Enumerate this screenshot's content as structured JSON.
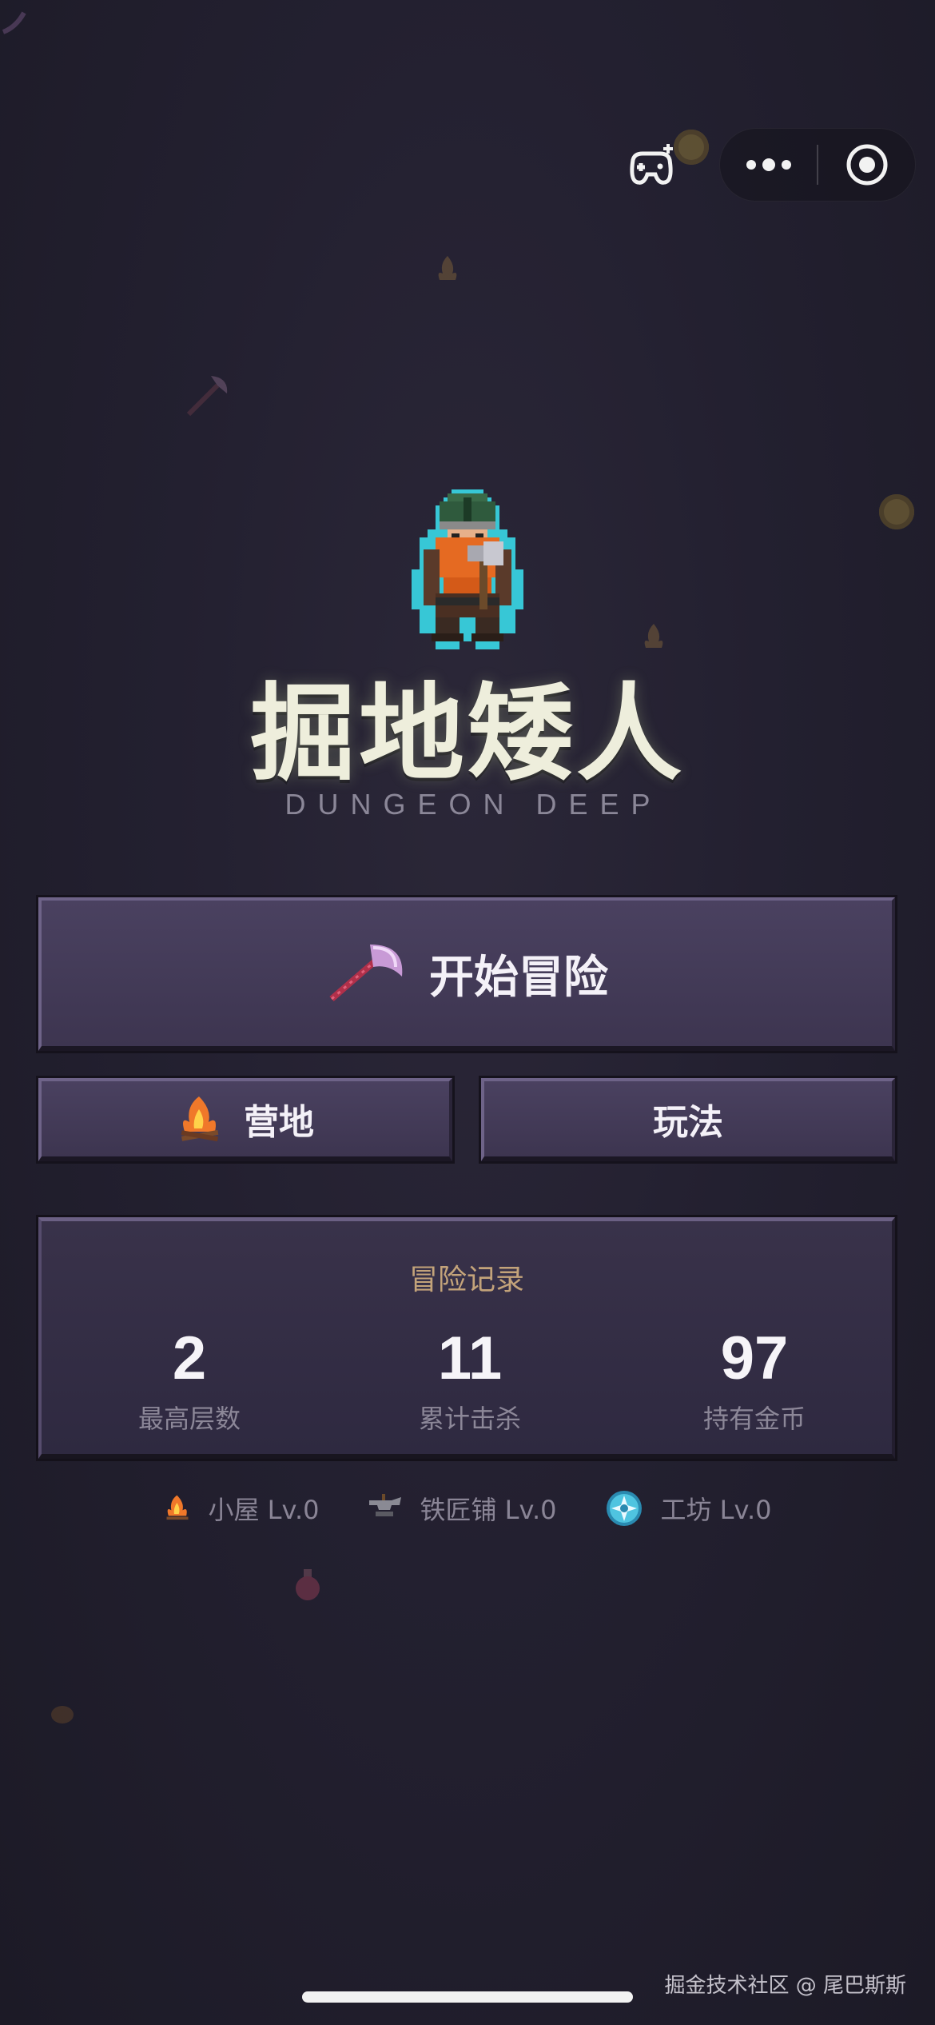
{
  "capsule": {
    "game_icon": "gamepad-plus-icon",
    "menu_icon": "more-dots-icon",
    "close_icon": "target-circle-icon"
  },
  "hero": {
    "sprite": "dwarf-warrior-sprite"
  },
  "title": "掘地矮人",
  "subtitle": "DUNGEON DEEP",
  "buttons": {
    "start": {
      "icon": "axe-icon",
      "label": "开始冒险"
    },
    "camp": {
      "icon": "campfire-icon",
      "label": "营地"
    },
    "help": {
      "label": "玩法"
    }
  },
  "stats": {
    "title": "冒险记录",
    "items": [
      {
        "value": "2",
        "label": "最高层数"
      },
      {
        "value": "11",
        "label": "累计击杀"
      },
      {
        "value": "97",
        "label": "持有金币"
      }
    ]
  },
  "buildings": [
    {
      "icon": "campfire-icon",
      "label": "小屋 Lv.0"
    },
    {
      "icon": "anvil-icon",
      "label": "铁匠铺 Lv.0"
    },
    {
      "icon": "workshop-gear-icon",
      "label": "工坊 Lv.0"
    }
  ],
  "watermark": "掘金技术社区 @ 尾巴斯斯",
  "colors": {
    "background": "#221f2d",
    "button": "#453c5a",
    "panel": "#352f46",
    "stats_title": "#c3a37a",
    "title": "#eeeedc"
  }
}
